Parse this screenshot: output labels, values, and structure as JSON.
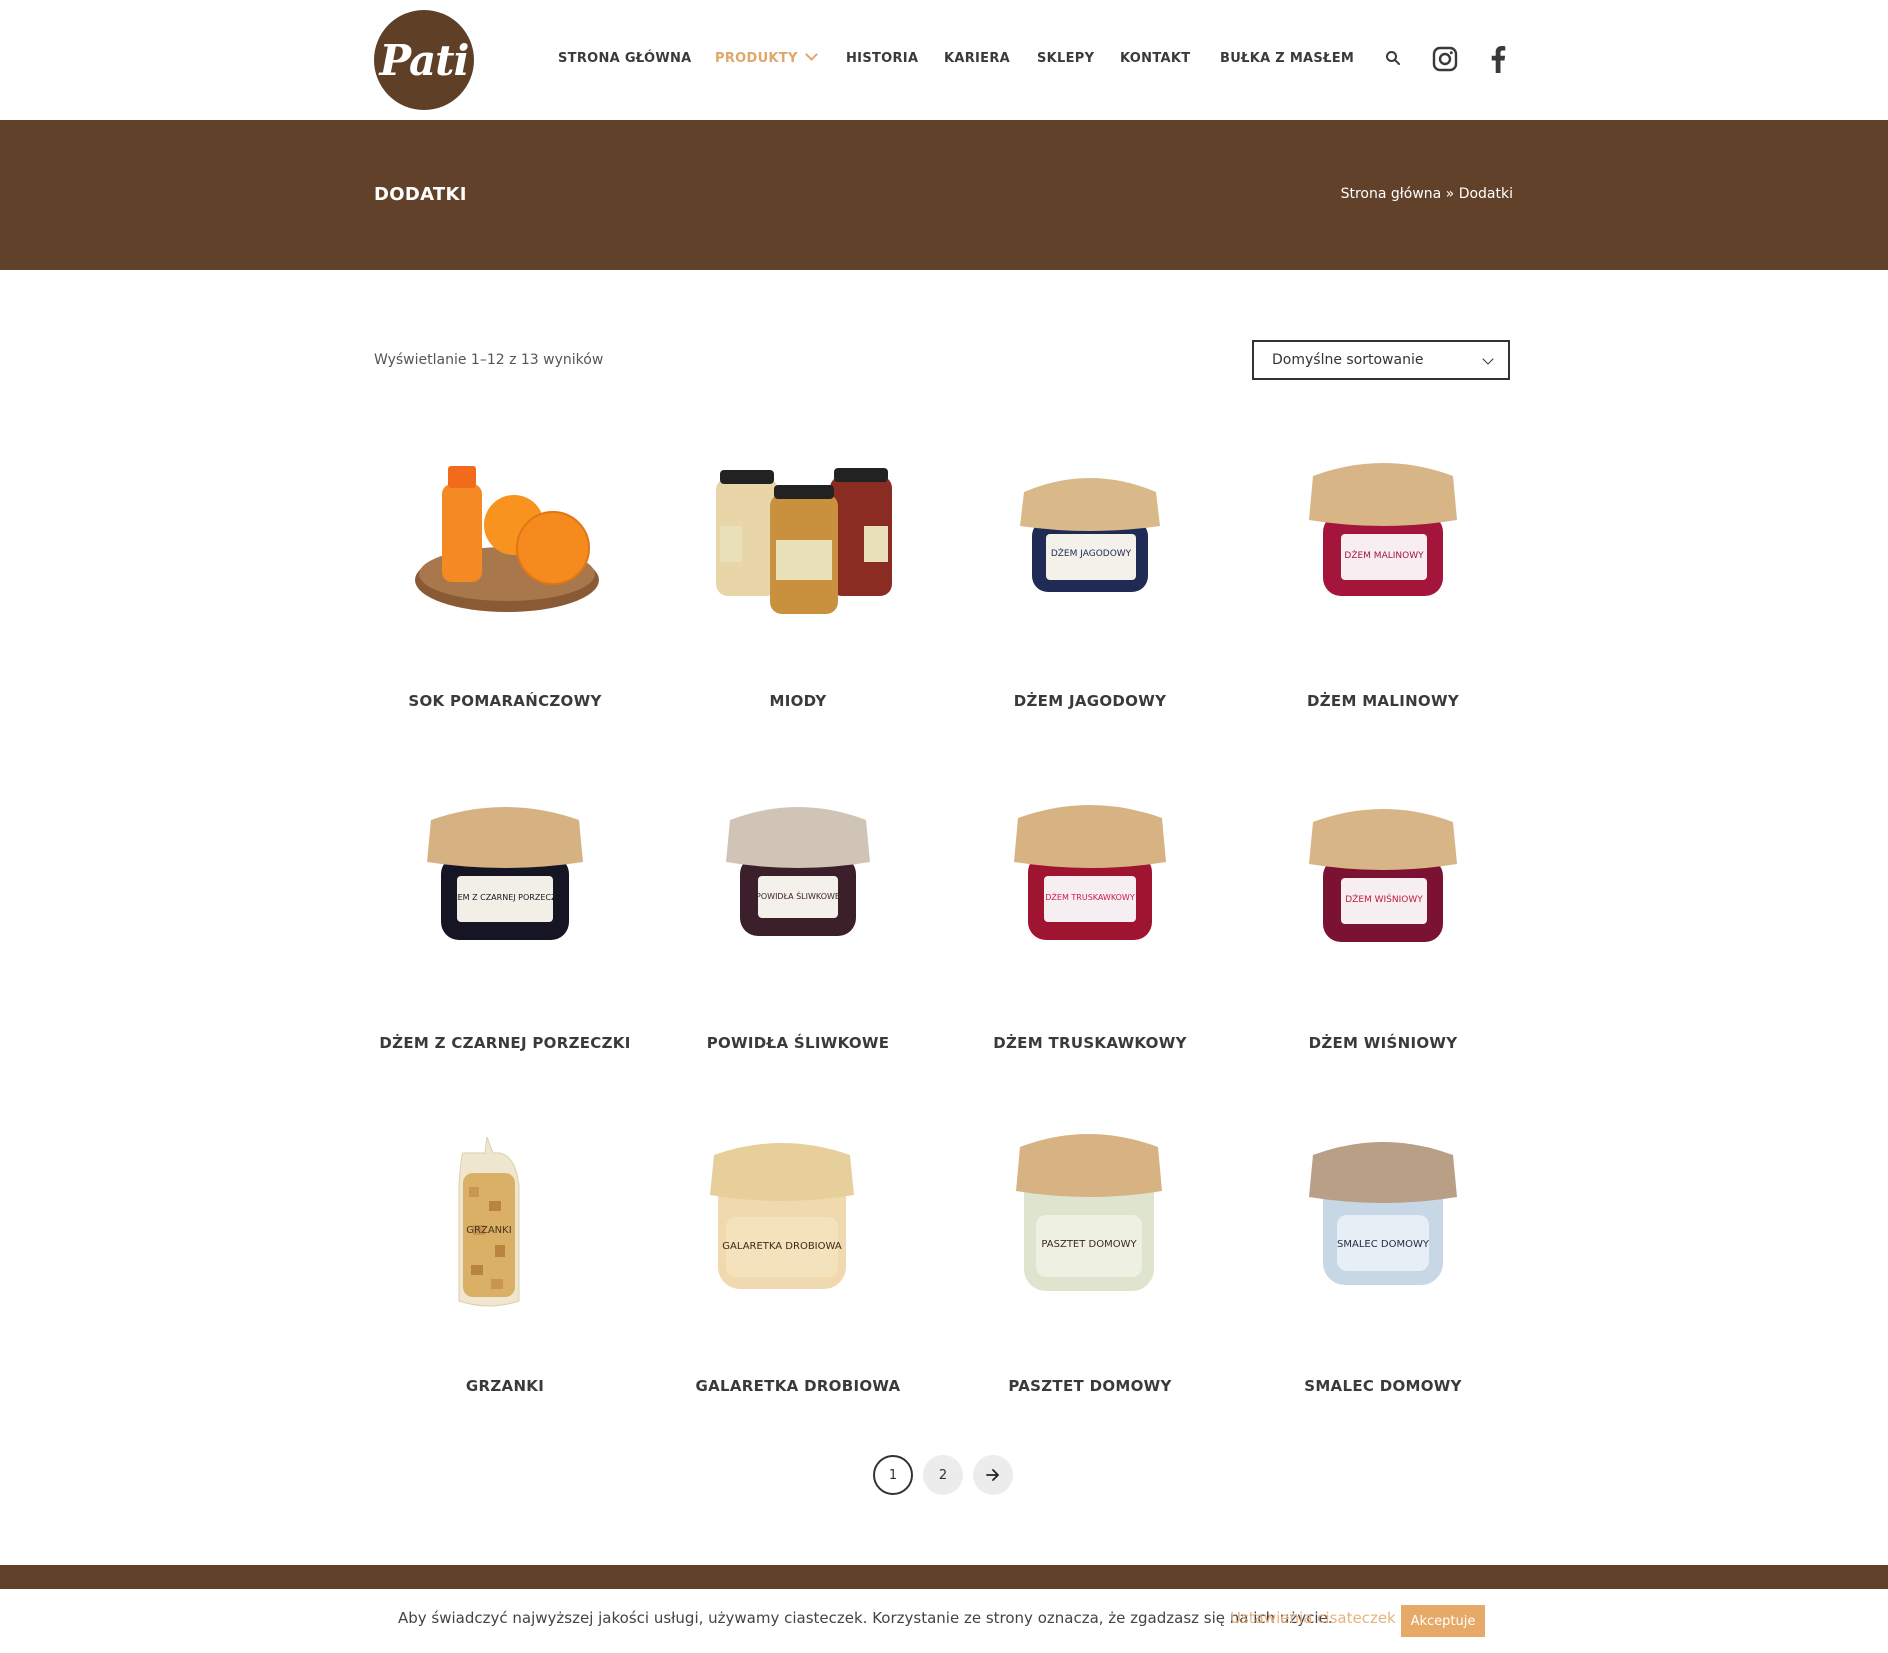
{
  "brand": {
    "logo_text": "Pati"
  },
  "nav": {
    "items": [
      {
        "label": "STRONA GŁÓWNA"
      },
      {
        "label": "PRODUKTY"
      },
      {
        "label": "HISTORIA"
      },
      {
        "label": "KARIERA"
      },
      {
        "label": "SKLEPY"
      },
      {
        "label": "KONTAKT"
      },
      {
        "label": "BUŁKA Z MASŁEM"
      }
    ],
    "active_index": 1,
    "icons": [
      "search-icon",
      "instagram-icon",
      "facebook-icon"
    ]
  },
  "banner": {
    "title": "DODATKI",
    "breadcrumb": {
      "home": "Strona główna",
      "separator": " » ",
      "current": "Dodatki"
    }
  },
  "toolbar": {
    "result_count": "Wyświetlanie 1–12 z 13 wyników",
    "sort_selected": "Domyślne sortowanie"
  },
  "products": [
    {
      "name": "SOK POMARAŃCZOWY"
    },
    {
      "name": "MIODY"
    },
    {
      "name": "DŻEM JAGODOWY"
    },
    {
      "name": "DŻEM MALINOWY"
    },
    {
      "name": "DŻEM Z CZARNEJ PORZECZKI"
    },
    {
      "name": "POWIDŁA ŚLIWKOWE"
    },
    {
      "name": "DŻEM TRUSKAWKOWY"
    },
    {
      "name": "DŻEM WIŚNIOWY"
    },
    {
      "name": "GRZANKI"
    },
    {
      "name": "GALARETKA DROBIOWA"
    },
    {
      "name": "PASZTET DOMOWY"
    },
    {
      "name": "SMALEC DOMOWY"
    }
  ],
  "labels": {
    "jagodowy": "DŻEM JAGODOWY",
    "malinowy": "DŻEM MALINOWY",
    "porzeczki": "DŻEM Z CZARNEJ PORZECZKI",
    "powidla": "POWIDŁA ŚLIWKOWE",
    "truskawkowy": "DŻEM TRUSKAWKOWY",
    "wisniowy": "DŻEM WIŚNIOWY",
    "grzanki": "GRZANKI",
    "galaretka": "GALARETKA DROBIOWA",
    "pasztet": "PASZTET DOMOWY",
    "smalec": "SMALEC DOMOWY"
  },
  "pagination": {
    "pages": [
      "1",
      "2"
    ],
    "current": "1",
    "next_icon": "arrow-right-icon"
  },
  "cookie": {
    "text": "Aby świadczyć najwyższej jakości usługi, używamy ciasteczek. Korzystanie ze strony oznacza, że zgadzasz się na ich użycie.",
    "settings_label": "Ustawienia cisateczek",
    "accept_label": "Akceptuje"
  },
  "colors": {
    "brand_brown": "#62412a",
    "accent": "#e0a76a",
    "button_accent": "#e7a967"
  }
}
